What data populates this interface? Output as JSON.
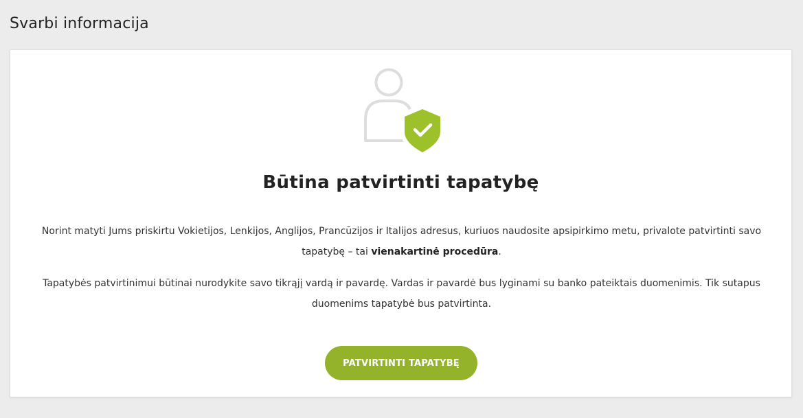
{
  "page": {
    "title": "Svarbi informacija"
  },
  "card": {
    "icon": "user-shield-check-icon",
    "heading": "Būtina patvirtinti tapatybę",
    "paragraph1": {
      "before": "Norint matyti Jums priskirtu Vokietijos, Lenkijos, Anglijos, Prancūzijos ir Italijos adresus, kuriuos naudosite apsipirkimo metu, privalote patvirtinti savo tapatybę – tai ",
      "bold": "vienakartinė procedūra",
      "after": "."
    },
    "paragraph2": "Tapatybės patvirtinimui būtinai nurodykite savo tikrąjį vardą ir pavardę. Vardas ir pavardė bus lyginami su banko pateiktais duomenimis. Tik sutapus duomenims tapatybė bus patvirtinta.",
    "button_label": "PATVIRTINTI TAPATYBĘ"
  },
  "colors": {
    "background": "#ececec",
    "card": "#ffffff",
    "accent": "#94b22a",
    "shield": "#9cc12b",
    "user_outline": "#dddddd"
  }
}
